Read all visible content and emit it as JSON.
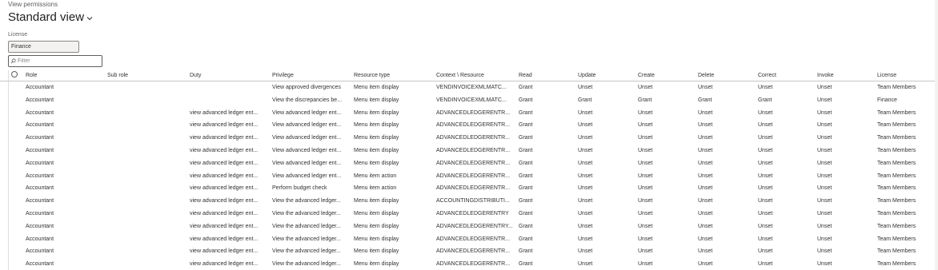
{
  "breadcrumb": "View permissions",
  "view": {
    "title": "Standard view",
    "chevron_icon": "chevron-down-icon"
  },
  "license": {
    "label": "License",
    "value": "Finance"
  },
  "filter": {
    "placeholder": "Filter",
    "icon": "search-icon"
  },
  "table": {
    "columns": [
      "Role",
      "Sub role",
      "Duty",
      "Privilege",
      "Resource type",
      "Context \\ Resource",
      "Read",
      "Update",
      "Create",
      "Delete",
      "Correct",
      "Invoke",
      "License"
    ],
    "rows": [
      [
        "Accountant",
        "",
        "",
        "View approved divergences",
        "Menu item display",
        "VENDINVOICEXMLMATC...",
        "Grant",
        "Unset",
        "Unset",
        "Unset",
        "Unset",
        "Unset",
        "Team Members"
      ],
      [
        "Accountant",
        "",
        "",
        "View the discrepancies be...",
        "Menu item display",
        "VENDINVOICEXMLMATC...",
        "Grant",
        "Grant",
        "Grant",
        "Grant",
        "Grant",
        "Unset",
        "Finance"
      ],
      [
        "Accountant",
        "",
        "view advanced ledger ent...",
        "View advanced ledger ent...",
        "Menu item display",
        "ADVANCEDLEDGERENTR...",
        "Grant",
        "Unset",
        "Unset",
        "Unset",
        "Unset",
        "Unset",
        "Team Members"
      ],
      [
        "Accountant",
        "",
        "view advanced ledger ent...",
        "View advanced ledger ent...",
        "Menu item display",
        "ADVANCEDLEDGERENTR...",
        "Grant",
        "Unset",
        "Unset",
        "Unset",
        "Unset",
        "Unset",
        "Team Members"
      ],
      [
        "Accountant",
        "",
        "view advanced ledger ent...",
        "View advanced ledger ent...",
        "Menu item display",
        "ADVANCEDLEDGERENTR...",
        "Grant",
        "Unset",
        "Unset",
        "Unset",
        "Unset",
        "Unset",
        "Team Members"
      ],
      [
        "Accountant",
        "",
        "view advanced ledger ent...",
        "View advanced ledger ent...",
        "Menu item display",
        "ADVANCEDLEDGERENTR...",
        "Grant",
        "Unset",
        "Unset",
        "Unset",
        "Unset",
        "Unset",
        "Team Members"
      ],
      [
        "Accountant",
        "",
        "view advanced ledger ent...",
        "View advanced ledger ent...",
        "Menu item display",
        "ADVANCEDLEDGERENTR...",
        "Grant",
        "Unset",
        "Unset",
        "Unset",
        "Unset",
        "Unset",
        "Team Members"
      ],
      [
        "Accountant",
        "",
        "view advanced ledger ent...",
        "View advanced ledger ent...",
        "Menu item action",
        "ADVANCEDLEDGERENTR...",
        "Grant",
        "Unset",
        "Unset",
        "Unset",
        "Unset",
        "Unset",
        "Team Members"
      ],
      [
        "Accountant",
        "",
        "view advanced ledger ent...",
        "Perform budget check",
        "Menu item action",
        "ADVANCEDLEDGERENTR...",
        "Grant",
        "Unset",
        "Unset",
        "Unset",
        "Unset",
        "Unset",
        "Team Members"
      ],
      [
        "Accountant",
        "",
        "view advanced ledger ent...",
        "View the advanced ledger...",
        "Menu item display",
        "ACCOUNTINGDISTRIBUTI...",
        "Grant",
        "Unset",
        "Unset",
        "Unset",
        "Unset",
        "Unset",
        "Team Members"
      ],
      [
        "Accountant",
        "",
        "view advanced ledger ent...",
        "View the advanced ledger...",
        "Menu item display",
        "ADVANCEDLEDGERENTRY",
        "Grant",
        "Unset",
        "Unset",
        "Unset",
        "Unset",
        "Unset",
        "Team Members"
      ],
      [
        "Accountant",
        "",
        "view advanced ledger ent...",
        "View the advanced ledger...",
        "Menu item display",
        "ADVANCEDLEDGERENTRY...",
        "Grant",
        "Unset",
        "Unset",
        "Unset",
        "Unset",
        "Unset",
        "Team Members"
      ],
      [
        "Accountant",
        "",
        "view advanced ledger ent...",
        "View the advanced ledger...",
        "Menu item display",
        "ADVANCEDLEDGERENTR...",
        "Grant",
        "Unset",
        "Unset",
        "Unset",
        "Unset",
        "Unset",
        "Team Members"
      ],
      [
        "Accountant",
        "",
        "view advanced ledger ent...",
        "View the advanced ledger...",
        "Menu item display",
        "ADVANCEDLEDGERENTR...",
        "Grant",
        "Unset",
        "Unset",
        "Unset",
        "Unset",
        "Unset",
        "Team Members"
      ],
      [
        "Accountant",
        "",
        "view advanced ledger ent...",
        "View the advanced ledger...",
        "Menu item display",
        "ADVANCEDLEDGERENTR...",
        "Grant",
        "Unset",
        "Unset",
        "Unset",
        "Unset",
        "Unset",
        "Team Members"
      ]
    ]
  }
}
